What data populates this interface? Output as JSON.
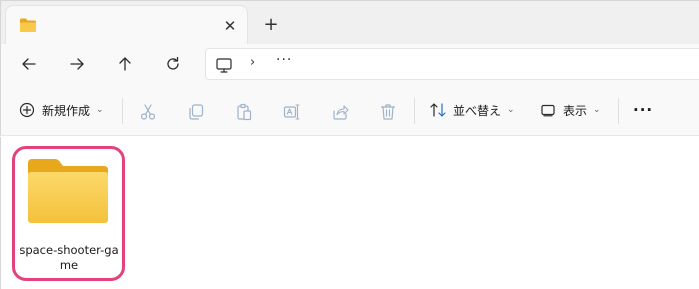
{
  "window": {
    "tab_close_glyph": "✕",
    "new_tab_glyph": "+"
  },
  "icons": {
    "tab": "folder-icon",
    "nav": [
      "back-arrow-icon",
      "forward-arrow-icon",
      "up-arrow-icon",
      "refresh-icon"
    ],
    "address": "this-pc-icon",
    "toolbar": [
      "new-icon",
      "cut-icon",
      "copy-icon",
      "paste-icon",
      "rename-icon",
      "share-icon",
      "delete-icon",
      "sort-icon",
      "view-icon",
      "more-icon"
    ]
  },
  "addressbar": {
    "chevron": "›",
    "overflow": "···"
  },
  "toolbar": {
    "new_label": "新規作成",
    "sort_label": "並べ替え",
    "view_label": "表示",
    "dropdown_glyph": "⌄",
    "more_glyph": "···"
  },
  "content": {
    "items": [
      {
        "name": "space-shooter-game",
        "type": "folder",
        "selected": true
      }
    ]
  },
  "colors": {
    "selection_outline": "#e4427d",
    "folder_body": "#f8c94a",
    "folder_tab": "#e8a81c",
    "icon_stroke": "#2b2b2b",
    "disabled_icon": "#9eb2c8"
  }
}
